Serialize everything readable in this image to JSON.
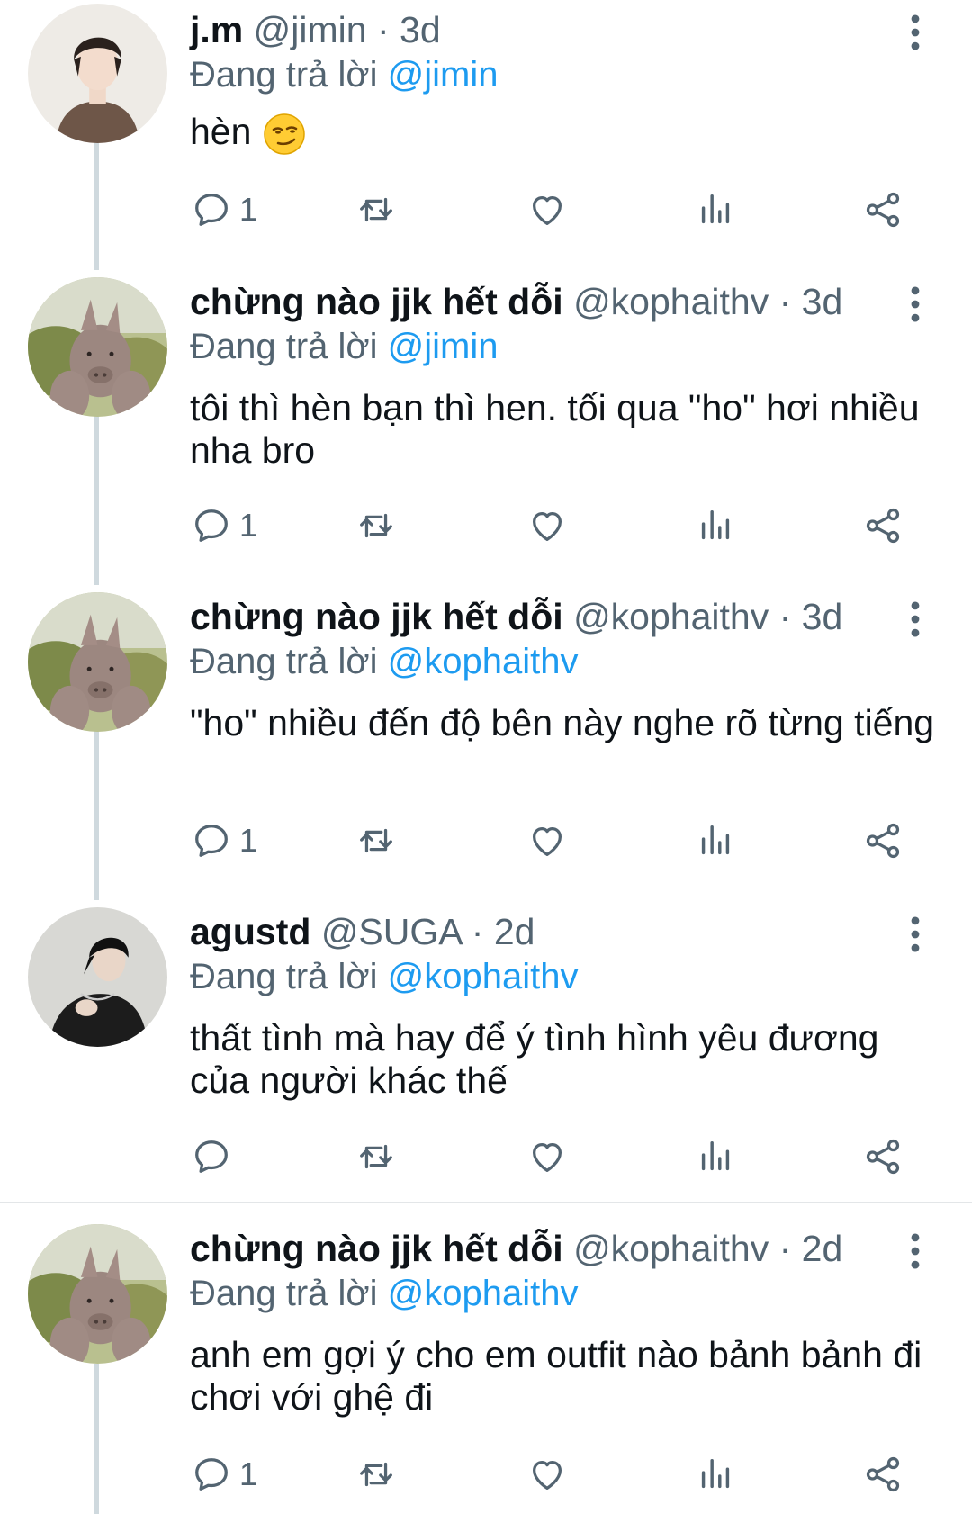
{
  "tweets": [
    {
      "name": "j.m",
      "handle": "@jimin",
      "dot": "·",
      "time": "3d",
      "reply_prefix": "Đang trả lời",
      "reply_to": "@jimin",
      "text": "hèn",
      "emoji": "smirk",
      "reply_count": "1",
      "avatar": "person-brown-sweater"
    },
    {
      "name": "chừng nào jjk hết dỗi",
      "handle": "@kophaithv",
      "dot": "·",
      "time": "3d",
      "reply_prefix": "Đang trả lời",
      "reply_to": "@jimin",
      "text": "tôi thì hèn bạn thì hen. tối qua \"ho\" hơi nhiều nha bro",
      "reply_count": "1",
      "avatar": "clay-pig"
    },
    {
      "name": "chừng nào jjk hết dỗi",
      "handle": "@kophaithv",
      "dot": "·",
      "time": "3d",
      "reply_prefix": "Đang trả lời",
      "reply_to": "@kophaithv",
      "text": "\"ho\" nhiều đến độ bên này nghe rõ từng tiếng",
      "reply_count": "1",
      "avatar": "clay-pig"
    },
    {
      "name": "agustd",
      "handle": "@SUGA",
      "dot": "·",
      "time": "2d",
      "reply_prefix": "Đang trả lời",
      "reply_to": "@kophaithv",
      "text": "thất tình mà hay để ý tình hình yêu đương của người khác thế",
      "reply_count": "",
      "avatar": "person-black-outfit"
    },
    {
      "name": "chừng nào jjk hết dỗi",
      "handle": "@kophaithv",
      "dot": "·",
      "time": "2d",
      "reply_prefix": "Đang trả lời",
      "reply_to": "@kophaithv",
      "text": "anh em gợi ý cho em outfit nào bảnh bảnh đi chơi với ghệ đi",
      "reply_count": "1",
      "avatar": "clay-pig"
    }
  ],
  "icons": {
    "reply": "reply-icon",
    "retweet": "retweet-icon",
    "like": "like-icon",
    "analytics": "analytics-icon",
    "share": "share-icon",
    "more": "more-icon"
  },
  "colors": {
    "link": "#1d9bf0",
    "secondary": "#536471",
    "thread_line": "#cfd9de"
  }
}
